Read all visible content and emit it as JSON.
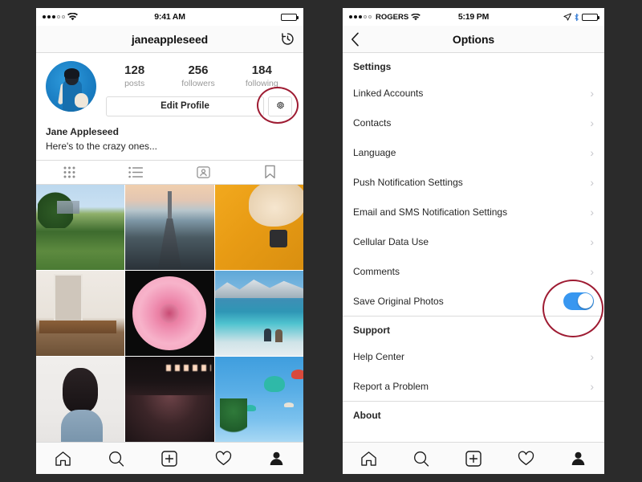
{
  "background_color": "#2b2b2b",
  "accent_colors": {
    "annotation_red": "#9e1b32",
    "toggle_on_blue": "#3897f0",
    "battery_green": "#49cc4a",
    "border_gray": "#dbdbdb",
    "text_primary": "#262626",
    "text_muted": "#999999"
  },
  "left_phone": {
    "status_bar": {
      "signal_dots_filled": 3,
      "signal_dots_total": 5,
      "wifi_icon": "wifi-icon",
      "time": "9:41 AM",
      "battery_icon": "battery-full-icon"
    },
    "navbar": {
      "title": "janeappleseed",
      "right_icon": "archive-history-icon"
    },
    "profile": {
      "avatar_icon": "profile-avatar",
      "stats": [
        {
          "value": "128",
          "label": "posts"
        },
        {
          "value": "256",
          "label": "followers"
        },
        {
          "value": "184",
          "label": "following"
        }
      ],
      "edit_button_label": "Edit Profile",
      "gear_icon": "gear-icon",
      "display_name": "Jane Appleseed",
      "bio": "Here's to the crazy ones..."
    },
    "profile_tabs": [
      {
        "icon": "grid-icon",
        "active": true
      },
      {
        "icon": "list-icon",
        "active": false
      },
      {
        "icon": "tagged-person-icon",
        "active": false
      },
      {
        "icon": "bookmark-icon",
        "active": false
      }
    ],
    "photo_grid": [
      {
        "alt": "city park with skyline",
        "style": "ph-park"
      },
      {
        "alt": "bay bridge at dusk",
        "style": "ph-bridge"
      },
      {
        "alt": "cat on yellow mat with camera",
        "style": "ph-cat"
      },
      {
        "alt": "dining room interior",
        "style": "ph-room"
      },
      {
        "alt": "pink gerbera daisy on black",
        "style": "ph-flower"
      },
      {
        "alt": "two people at mountain lake",
        "style": "ph-lake"
      },
      {
        "alt": "woman from behind on white wall",
        "style": "ph-woman"
      },
      {
        "alt": "concert crowd with stage lights",
        "style": "ph-concert"
      },
      {
        "alt": "swing carousel ride against blue sky",
        "style": "ph-swing"
      }
    ],
    "bottom_nav": [
      {
        "icon": "home-icon",
        "active": false
      },
      {
        "icon": "search-icon",
        "active": false
      },
      {
        "icon": "add-post-icon",
        "active": false
      },
      {
        "icon": "heart-icon",
        "active": false
      },
      {
        "icon": "profile-icon",
        "active": true
      }
    ]
  },
  "right_phone": {
    "status_bar": {
      "signal_dots_filled": 3,
      "signal_dots_total": 5,
      "carrier": "ROGERS",
      "wifi_icon": "wifi-icon",
      "time": "5:19 PM",
      "location_icon": "location-arrow-icon",
      "bluetooth_icon": "bluetooth-icon",
      "battery_icon": "battery-charged-icon"
    },
    "navbar": {
      "back_icon": "chevron-left-icon",
      "title": "Options"
    },
    "sections": [
      {
        "header": "Settings",
        "rows": [
          {
            "label": "Linked Accounts",
            "control": "chevron"
          },
          {
            "label": "Contacts",
            "control": "chevron"
          },
          {
            "label": "Language",
            "control": "chevron"
          },
          {
            "label": "Push Notification Settings",
            "control": "chevron"
          },
          {
            "label": "Email and SMS Notification Settings",
            "control": "chevron"
          },
          {
            "label": "Cellular Data Use",
            "control": "chevron"
          },
          {
            "label": "Comments",
            "control": "chevron"
          },
          {
            "label": "Save Original Photos",
            "control": "toggle",
            "toggle_on": true
          }
        ]
      },
      {
        "header": "Support",
        "rows": [
          {
            "label": "Help Center",
            "control": "chevron"
          },
          {
            "label": "Report a Problem",
            "control": "chevron"
          }
        ]
      },
      {
        "header": "About",
        "rows": []
      }
    ],
    "bottom_nav": [
      {
        "icon": "home-icon",
        "active": false
      },
      {
        "icon": "search-icon",
        "active": false
      },
      {
        "icon": "add-post-icon",
        "active": false
      },
      {
        "icon": "heart-icon",
        "active": false
      },
      {
        "icon": "profile-icon",
        "active": true
      }
    ]
  },
  "annotations": [
    {
      "name": "gear-button-highlight",
      "shape": "circle",
      "color": "#9e1b32"
    },
    {
      "name": "save-original-photos-toggle-highlight",
      "shape": "circle",
      "color": "#9e1b32"
    }
  ],
  "chevron_glyph": "›"
}
